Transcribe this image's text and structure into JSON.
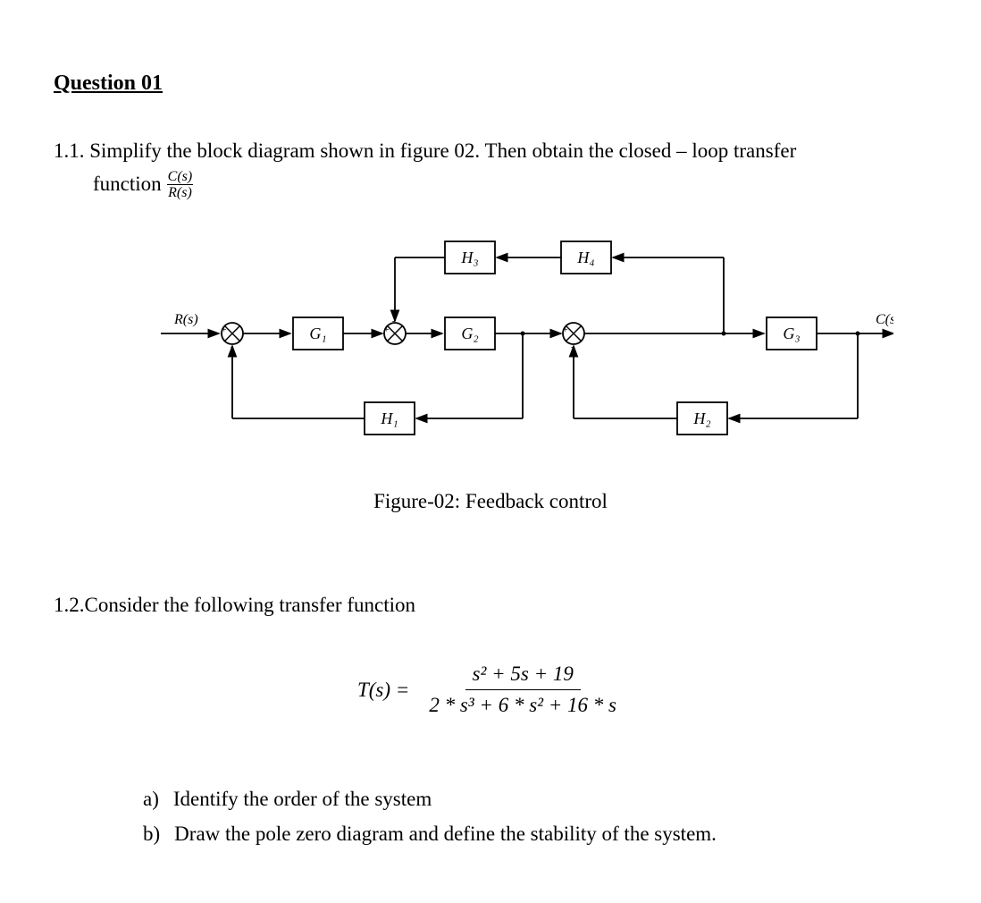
{
  "question_title": "Question 01",
  "q11": {
    "number": "1.1.",
    "text_line1": "Simplify the block diagram shown in figure 02. Then obtain the closed – loop transfer",
    "func_word": "function",
    "frac_num": "C(s)",
    "frac_den": "R(s)"
  },
  "diagram": {
    "input": "R(s)",
    "output": "C(s)",
    "G1": "G₁",
    "G2": "G₂",
    "G3": "G₃",
    "H1": "H₁",
    "H2": "H₂",
    "H3": "H₃",
    "H4": "H₄",
    "caption": "Figure-02: Feedback control"
  },
  "q12": {
    "intro": "1.2.Consider the following transfer function",
    "lhs": "T(s) =",
    "num": "s² + 5s + 19",
    "den": "2 * s³ + 6 * s² + 16 * s",
    "a_marker": "a)",
    "a_text": "Identify the order of the system",
    "b_marker": "b)",
    "b_text": "Draw the pole zero diagram and define the stability of the system."
  }
}
